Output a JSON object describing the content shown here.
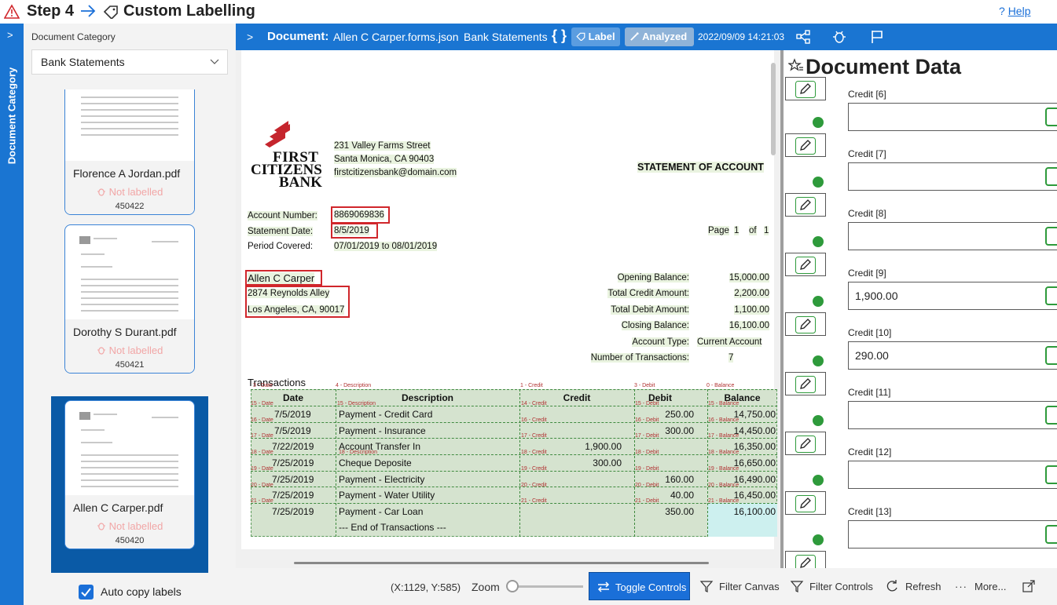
{
  "header": {
    "step": "Step 4",
    "title": "Custom Labelling",
    "help_prefix": "?",
    "help": "Help"
  },
  "rail": {
    "label": "Document Category"
  },
  "sidebar": {
    "category_label": "Document Category",
    "category_value": "Bank Statements",
    "documents": [
      {
        "name": "Florence A Jordan.pdf",
        "status": "Not labelled",
        "id": "450422"
      },
      {
        "name": "Dorothy S Durant.pdf",
        "status": "Not labelled",
        "id": "450421"
      },
      {
        "name": "Allen C Carper.pdf",
        "status": "Not labelled",
        "id": "450420"
      }
    ],
    "auto_copy": "Auto copy labels"
  },
  "doc_header": {
    "prefix": "Document:",
    "filename": "Allen C Carper.forms.json",
    "category": "Bank Statements",
    "braces": "{ }",
    "label_btn": "Label",
    "analyzed_btn": "Analyzed",
    "timestamp": "2022/09/09 14:21:03"
  },
  "statement": {
    "bank_address1": "231 Valley Farms Street",
    "bank_address2": "Santa Monica, CA 90403",
    "bank_email": "firstcitizensbank@domain.com",
    "logo_line1": "FIRST",
    "logo_line2": "CITIZENS",
    "logo_line3": "BANK",
    "doc_title": "STATEMENT OF ACCOUNT",
    "account_number_label": "Account Number:",
    "account_number": "8869069836",
    "statement_date_label": "Statement Date:",
    "statement_date": "8/5/2019",
    "period_label": "Period Covered:",
    "period": "07/01/2019 to 08/01/2019",
    "page_label": "Page",
    "page_num": "1",
    "page_of": "of",
    "page_total": "1",
    "customer_name": "Allen C Carper",
    "customer_addr1": "2874 Reynolds Alley",
    "customer_addr2": "Los Angeles, CA, 90017",
    "summary": [
      {
        "label": "Opening Balance:",
        "value": "15,000.00"
      },
      {
        "label": "Total Credit Amount:",
        "value": "2,200.00"
      },
      {
        "label": "Total Debit Amount:",
        "value": "1,100.00"
      },
      {
        "label": "Closing Balance:",
        "value": "16,100.00"
      },
      {
        "label": "Account Type:",
        "value": "Current Account"
      },
      {
        "label": "Number of Transactions:",
        "value": "7"
      }
    ],
    "transactions_title": "Transactions",
    "columns": [
      "Date",
      "Description",
      "Credit",
      "Debit",
      "Balance"
    ],
    "column_tags": [
      "3 - Date",
      "4 - Description",
      "1 - Credit",
      "3 - Debit",
      "0 - Balance"
    ],
    "header_tags": [
      "15 - Date",
      "15 - Description",
      "14 - Credit",
      "15 - Debit",
      "15 - Balance"
    ],
    "rows": [
      {
        "date": "7/5/2019",
        "desc": "Payment - Credit Card",
        "credit": "",
        "debit": "250.00",
        "balance": "14,750.00",
        "tag": "16"
      },
      {
        "date": "7/5/2019",
        "desc": "Payment - Insurance",
        "credit": "",
        "debit": "300.00",
        "balance": "14,450.00",
        "tag": "17"
      },
      {
        "date": "7/22/2019",
        "desc": "Account Transfer In",
        "credit": "1,900.00",
        "debit": "",
        "balance": "16,350.00",
        "tag": "18"
      },
      {
        "date": "7/25/2019",
        "desc": "Cheque Deposite",
        "credit": "300.00",
        "debit": "",
        "balance": "16,650.00",
        "tag": "19"
      },
      {
        "date": "7/25/2019",
        "desc": "Payment - Electricity",
        "credit": "",
        "debit": "160.00",
        "balance": "16,490.00",
        "tag": "20"
      },
      {
        "date": "7/25/2019",
        "desc": "Payment - Water Utility",
        "credit": "",
        "debit": "40.00",
        "balance": "16,450.00",
        "tag": "21"
      },
      {
        "date": "7/25/2019",
        "desc": "Payment - Car Loan",
        "credit": "",
        "debit": "350.00",
        "balance": "16,100.00",
        "tag": ""
      }
    ],
    "end_text": "--- End of Transactions ---",
    "tag_date": "Date",
    "tag_description": "Description",
    "tag_credit": "Credit",
    "tag_debit": "Debit",
    "tag_balance": "Balance"
  },
  "data_panel": {
    "title": "Document Data",
    "fields": [
      {
        "label": "Credit [6]",
        "value": ""
      },
      {
        "label": "Credit [7]",
        "value": ""
      },
      {
        "label": "Credit [8]",
        "value": ""
      },
      {
        "label": "Credit [9]",
        "value": "1,900.00"
      },
      {
        "label": "Credit [10]",
        "value": "290.00"
      },
      {
        "label": "Credit [11]",
        "value": ""
      },
      {
        "label": "Credit [12]",
        "value": ""
      },
      {
        "label": "Credit [13]",
        "value": ""
      }
    ]
  },
  "toolbar": {
    "coords": "(X:1129, Y:585)",
    "zoom": "Zoom",
    "zoom_level": 0.0,
    "toggle_controls": "Toggle Controls",
    "filter_canvas": "Filter Canvas",
    "filter_controls": "Filter Controls",
    "refresh": "Refresh",
    "more_prefix": "···",
    "more": "More..."
  },
  "colors": {
    "accent": "#1a75d2",
    "label_box": "#d0262b",
    "table_fill": "#d5e3cf",
    "status_dot": "#2e9a3b",
    "not_labelled": "#f2a6a6"
  }
}
